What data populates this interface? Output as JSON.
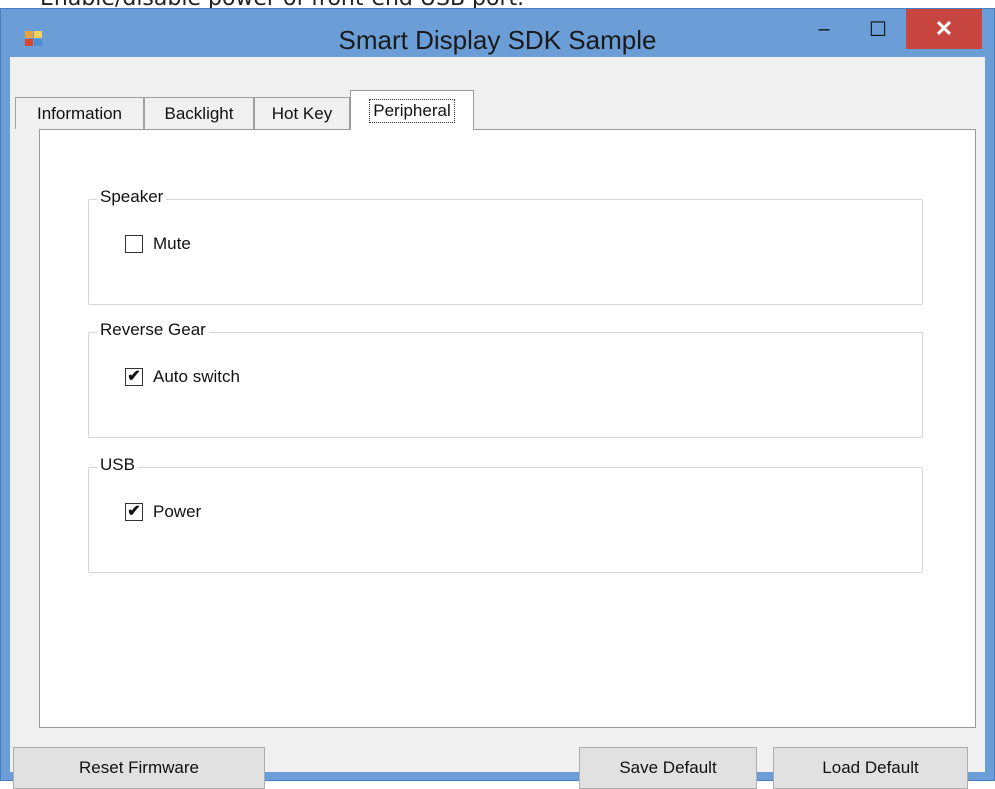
{
  "document_text": "Enable/disable power of front-end USB port.",
  "window": {
    "title": "Smart Display SDK Sample",
    "minimize_glyph": "–",
    "maximize_glyph": "☐",
    "close_glyph": "✕",
    "app_icon": "app-icon",
    "colors": {
      "frame": "#6b9dd6",
      "close": "#c7463f",
      "client": "#f0f0f0"
    }
  },
  "tabs": [
    {
      "label": "Information",
      "active": false
    },
    {
      "label": "Backlight",
      "active": false
    },
    {
      "label": "Hot Key",
      "active": false
    },
    {
      "label": "Peripheral",
      "active": true
    }
  ],
  "peripheral": {
    "groups": [
      {
        "legend": "Speaker",
        "checkbox_label": "Mute",
        "checked": false,
        "check_glyph": ""
      },
      {
        "legend": "Reverse Gear",
        "checkbox_label": "Auto switch",
        "checked": true,
        "check_glyph": "✔"
      },
      {
        "legend": "USB",
        "checkbox_label": "Power",
        "checked": true,
        "check_glyph": "✔"
      }
    ]
  },
  "buttons": {
    "reset_firmware": "Reset Firmware",
    "save_default": "Save Default",
    "load_default": "Load Default"
  }
}
